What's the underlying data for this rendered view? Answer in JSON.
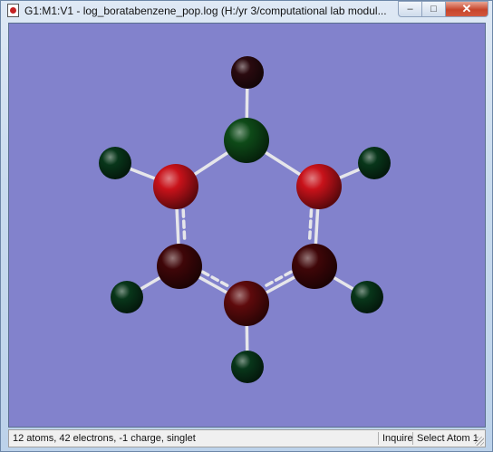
{
  "window": {
    "title": "G1:M1:V1 - log_boratabenzene_pop.log (H:/yr 3/computational lab modul...",
    "minimize_label": "–",
    "maximize_label": "□",
    "close_label": "✕"
  },
  "viewer": {
    "background": "#8282cc",
    "molecule": "boratabenzene",
    "atoms": [
      {
        "id": "H-top",
        "kind": "H",
        "color": "#2a0a0f"
      },
      {
        "id": "B",
        "kind": "B",
        "color": "#0e4a18"
      },
      {
        "id": "C-left",
        "kind": "C",
        "color": "#c8121a"
      },
      {
        "id": "C-right",
        "kind": "C",
        "color": "#c8121a"
      },
      {
        "id": "H-upper-left",
        "kind": "H",
        "color": "#08361a"
      },
      {
        "id": "H-upper-right",
        "kind": "H",
        "color": "#08361a"
      },
      {
        "id": "C-lower-left",
        "kind": "C",
        "color": "#3f0608"
      },
      {
        "id": "C-lower-right",
        "kind": "C",
        "color": "#3f0608"
      },
      {
        "id": "C-bottom",
        "kind": "C",
        "color": "#5e0a0c"
      },
      {
        "id": "H-lower-left",
        "kind": "H",
        "color": "#08361a"
      },
      {
        "id": "H-lower-right",
        "kind": "H",
        "color": "#08361a"
      },
      {
        "id": "H-bottom",
        "kind": "H",
        "color": "#08361a"
      }
    ]
  },
  "status": {
    "summary": "12 atoms, 42 electrons, -1 charge, singlet",
    "mode": "Inquire",
    "action": "Select Atom 1"
  }
}
